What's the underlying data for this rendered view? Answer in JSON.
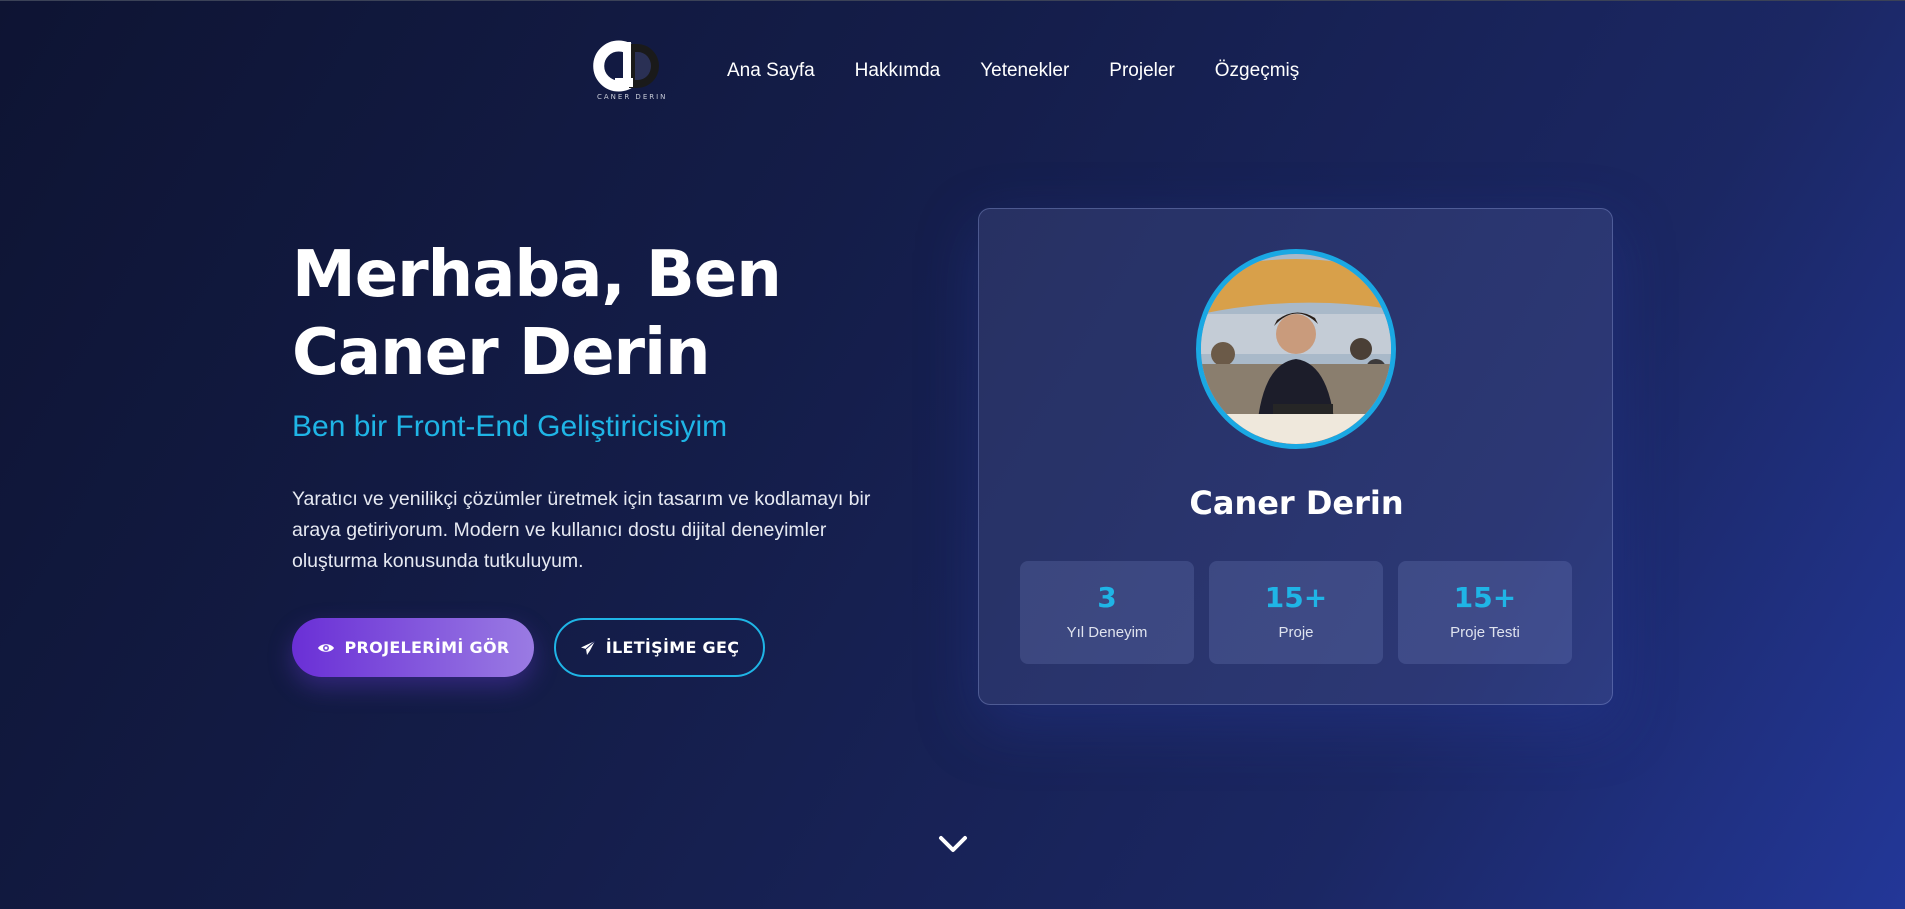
{
  "brand": {
    "logo_letters": "CD",
    "logo_caption": "CANER DERIN"
  },
  "nav": {
    "items": [
      {
        "label": "Ana Sayfa"
      },
      {
        "label": "Hakkımda"
      },
      {
        "label": "Yetenekler"
      },
      {
        "label": "Projeler"
      },
      {
        "label": "Özgeçmiş"
      }
    ]
  },
  "hero": {
    "title_line1": "Merhaba, Ben",
    "title_line2": "Caner Derin",
    "subtitle": "Ben bir Front-End Geliştiricisiyim",
    "description": "Yaratıcı ve yenilikçi çözümler üretmek için tasarım ve kodlamayı bir araya getiriyorum. Modern ve kullanıcı dostu dijital deneyimler oluşturma konusunda tutkuluyum.",
    "buttons": {
      "primary_label": "PROJELERİMİ GÖR",
      "primary_icon": "eye-icon",
      "secondary_label": "İLETİŞİME GEÇ",
      "secondary_icon": "paper-plane-icon"
    }
  },
  "profile": {
    "name": "Caner Derin",
    "stats": [
      {
        "value": "3",
        "label": "Yıl Deneyim"
      },
      {
        "value": "15+",
        "label": "Proje"
      },
      {
        "value": "15+",
        "label": "Proje Testi"
      }
    ]
  },
  "scroll": {
    "icon": "chevron-down-icon"
  },
  "colors": {
    "accent": "#1fb5e6",
    "primary_gradient_start": "#6a2fd6",
    "primary_gradient_end": "#9a7be3",
    "background_dark": "#0e1433",
    "background_light": "#233798"
  }
}
